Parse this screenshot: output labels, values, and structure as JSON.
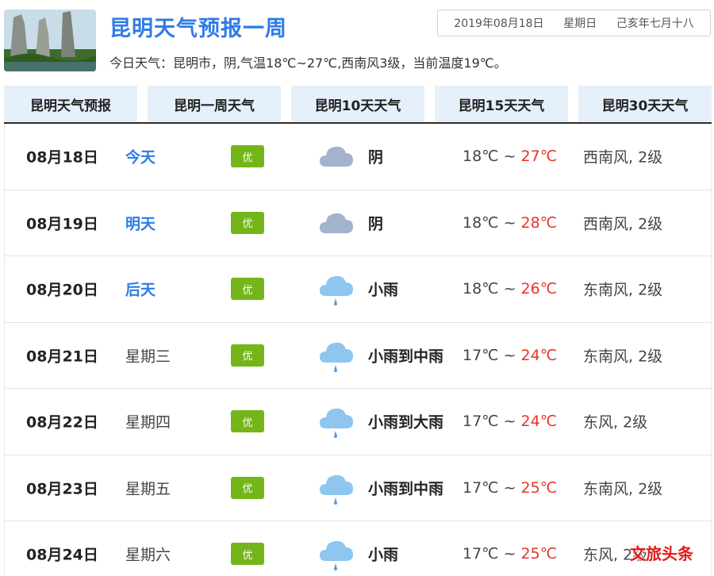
{
  "header": {
    "title": "昆明天气预报一周",
    "date": "2019年08月18日",
    "weekday": "星期日",
    "lunar": "己亥年七月十八",
    "summary": "今日天气：昆明市，阴,气温18℃~27℃,西南风3级，当前温度19℃。"
  },
  "tabs": [
    "昆明天气预报",
    "昆明一周天气",
    "昆明10天天气",
    "昆明15天天气",
    "昆明30天天气"
  ],
  "rows": [
    {
      "date": "08月18日",
      "day": "今天",
      "aqi": "优",
      "icon": "cloud-icon",
      "cond": "阴",
      "low": "18℃",
      "sep": "~",
      "high": "27℃",
      "wind": "西南风, 2级"
    },
    {
      "date": "08月19日",
      "day": "明天",
      "aqi": "优",
      "icon": "cloud-icon",
      "cond": "阴",
      "low": "18℃",
      "sep": "~",
      "high": "28℃",
      "wind": "西南风, 2级"
    },
    {
      "date": "08月20日",
      "day": "后天",
      "aqi": "优",
      "icon": "rain-icon",
      "cond": "小雨",
      "low": "18℃",
      "sep": "~",
      "high": "26℃",
      "wind": "东南风, 2级"
    },
    {
      "date": "08月21日",
      "day": "星期三",
      "aqi": "优",
      "icon": "rain-icon",
      "cond": "小雨到中雨",
      "low": "17℃",
      "sep": "~",
      "high": "24℃",
      "wind": "东南风, 2级"
    },
    {
      "date": "08月22日",
      "day": "星期四",
      "aqi": "优",
      "icon": "rain-icon",
      "cond": "小雨到大雨",
      "low": "17℃",
      "sep": "~",
      "high": "24℃",
      "wind": "东风, 2级"
    },
    {
      "date": "08月23日",
      "day": "星期五",
      "aqi": "优",
      "icon": "rain-icon",
      "cond": "小雨到中雨",
      "low": "17℃",
      "sep": "~",
      "high": "25℃",
      "wind": "东南风, 2级"
    },
    {
      "date": "08月24日",
      "day": "星期六",
      "aqi": "优",
      "icon": "rain-icon",
      "cond": "小雨",
      "low": "17℃",
      "sep": "~",
      "high": "25℃",
      "wind": "东风, 2级"
    }
  ],
  "watermark": "文旅头条",
  "colors": {
    "accent": "#2e7be8",
    "aqi_good": "#74b61a",
    "high_temp": "#e8332a",
    "tab_bg": "#e6f0fb"
  }
}
